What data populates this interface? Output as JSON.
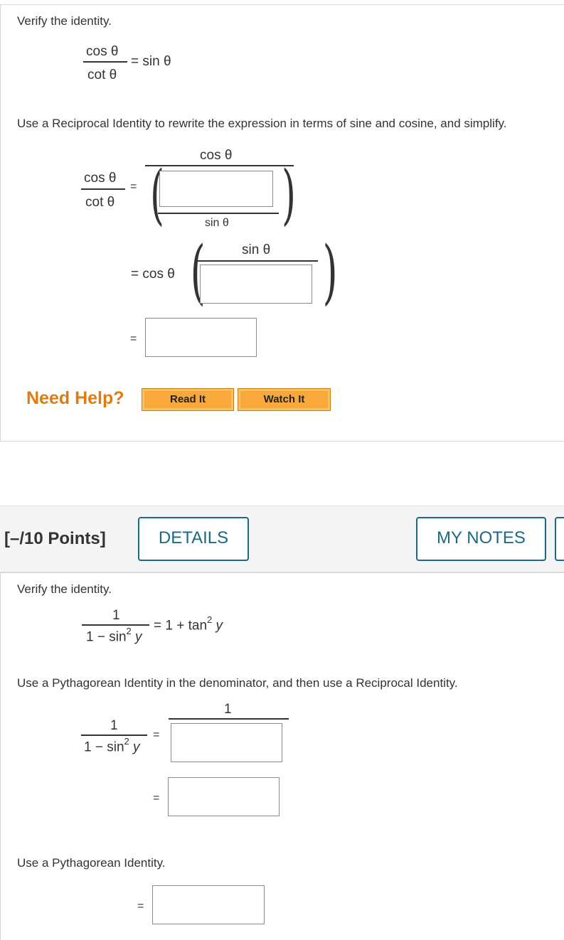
{
  "q1": {
    "prompt": "Verify the identity.",
    "identity_num": "cos θ",
    "identity_den": "cot θ",
    "identity_rhs": "= sin θ",
    "instruction": "Use a Reciprocal Identity to rewrite the expression in terms of sine and cosine, and simplify.",
    "lhs_num": "cos θ",
    "lhs_den": "cot θ",
    "eq": "=",
    "step1_top": "cos θ",
    "step1_inner_den": "sin θ",
    "step2_prefix": "= cos θ",
    "step2_num": "sin θ",
    "step3_eq": "=",
    "answer1": "",
    "answer2": "",
    "answer3": ""
  },
  "help": {
    "label": "Need Help?",
    "read_it": "Read It",
    "watch_it": "Watch It"
  },
  "q2_header": {
    "points": "[–/10 Points]",
    "details": "DETAILS",
    "my_notes": "MY NOTES"
  },
  "q2": {
    "prompt": "Verify the identity.",
    "identity_num": "1",
    "identity_den_base": "1 − sin",
    "identity_den_exp": "2",
    "identity_den_var": "y",
    "identity_rhs_base": "= 1 + tan",
    "identity_rhs_exp": "2",
    "identity_rhs_var": "y",
    "instruction": "Use a Pythagorean Identity in the denominator, and then use a Reciprocal Identity.",
    "lhs_num": "1",
    "lhs_den_base": "1 − sin",
    "lhs_den_exp": "2",
    "lhs_den_var": "y",
    "eq": "=",
    "step1_num": "1",
    "step2_eq": "=",
    "instruction2": "Use a Pythagorean Identity.",
    "step3_eq": "=",
    "answer1": "",
    "answer2": "",
    "answer3": ""
  }
}
